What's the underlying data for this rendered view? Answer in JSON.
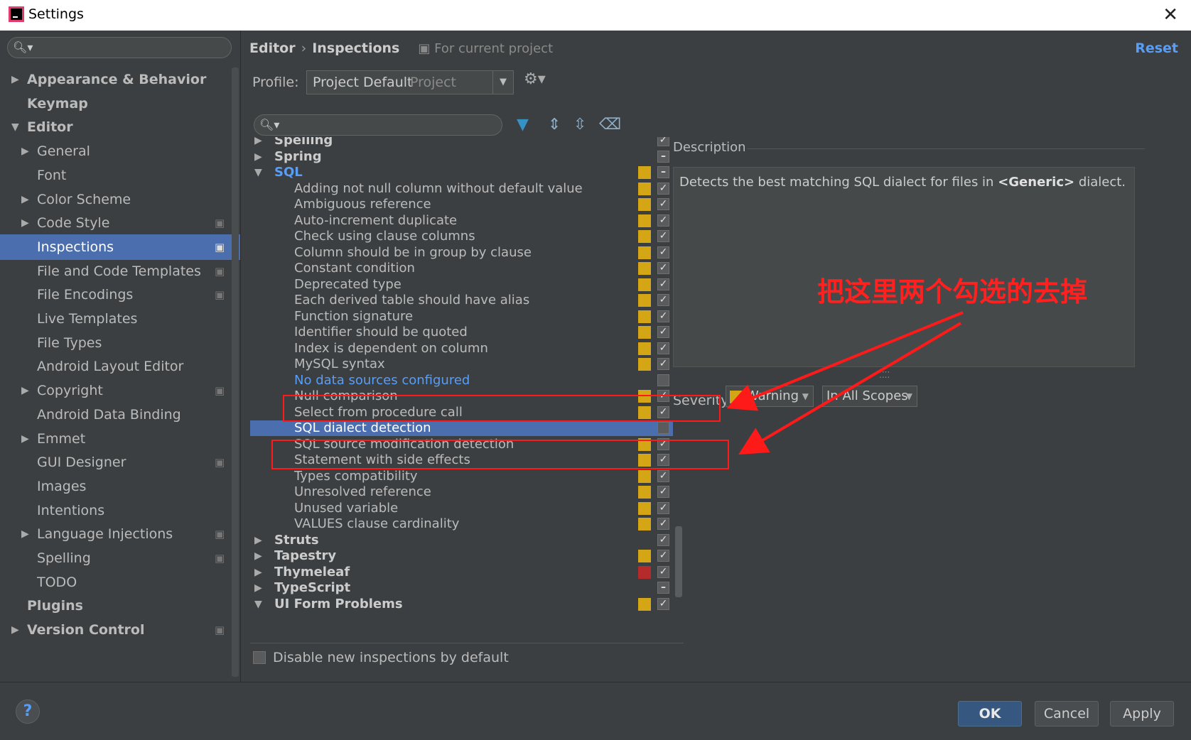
{
  "window": {
    "title": "Settings",
    "close_glyph": "✕"
  },
  "sidebar": {
    "items": [
      {
        "label": "Appearance & Behavior",
        "indent": 0,
        "arrow": "▶",
        "bold": true,
        "proj": false,
        "selected": false
      },
      {
        "label": "Keymap",
        "indent": 0,
        "arrow": "",
        "bold": true,
        "proj": false,
        "selected": false
      },
      {
        "label": "Editor",
        "indent": 0,
        "arrow": "▼",
        "bold": true,
        "proj": false,
        "selected": false
      },
      {
        "label": "General",
        "indent": 1,
        "arrow": "▶",
        "bold": false,
        "proj": false,
        "selected": false
      },
      {
        "label": "Font",
        "indent": 1,
        "arrow": "",
        "bold": false,
        "proj": false,
        "selected": false
      },
      {
        "label": "Color Scheme",
        "indent": 1,
        "arrow": "▶",
        "bold": false,
        "proj": false,
        "selected": false
      },
      {
        "label": "Code Style",
        "indent": 1,
        "arrow": "▶",
        "bold": false,
        "proj": true,
        "selected": false
      },
      {
        "label": "Inspections",
        "indent": 1,
        "arrow": "",
        "bold": false,
        "proj": true,
        "selected": true
      },
      {
        "label": "File and Code Templates",
        "indent": 1,
        "arrow": "",
        "bold": false,
        "proj": true,
        "selected": false
      },
      {
        "label": "File Encodings",
        "indent": 1,
        "arrow": "",
        "bold": false,
        "proj": true,
        "selected": false
      },
      {
        "label": "Live Templates",
        "indent": 1,
        "arrow": "",
        "bold": false,
        "proj": false,
        "selected": false
      },
      {
        "label": "File Types",
        "indent": 1,
        "arrow": "",
        "bold": false,
        "proj": false,
        "selected": false
      },
      {
        "label": "Android Layout Editor",
        "indent": 1,
        "arrow": "",
        "bold": false,
        "proj": false,
        "selected": false
      },
      {
        "label": "Copyright",
        "indent": 1,
        "arrow": "▶",
        "bold": false,
        "proj": true,
        "selected": false
      },
      {
        "label": "Android Data Binding",
        "indent": 1,
        "arrow": "",
        "bold": false,
        "proj": false,
        "selected": false
      },
      {
        "label": "Emmet",
        "indent": 1,
        "arrow": "▶",
        "bold": false,
        "proj": false,
        "selected": false
      },
      {
        "label": "GUI Designer",
        "indent": 1,
        "arrow": "",
        "bold": false,
        "proj": true,
        "selected": false
      },
      {
        "label": "Images",
        "indent": 1,
        "arrow": "",
        "bold": false,
        "proj": false,
        "selected": false
      },
      {
        "label": "Intentions",
        "indent": 1,
        "arrow": "",
        "bold": false,
        "proj": false,
        "selected": false
      },
      {
        "label": "Language Injections",
        "indent": 1,
        "arrow": "▶",
        "bold": false,
        "proj": true,
        "selected": false
      },
      {
        "label": "Spelling",
        "indent": 1,
        "arrow": "",
        "bold": false,
        "proj": true,
        "selected": false
      },
      {
        "label": "TODO",
        "indent": 1,
        "arrow": "",
        "bold": false,
        "proj": false,
        "selected": false
      },
      {
        "label": "Plugins",
        "indent": 0,
        "arrow": "",
        "bold": true,
        "proj": false,
        "selected": false
      },
      {
        "label": "Version Control",
        "indent": 0,
        "arrow": "▶",
        "bold": true,
        "proj": true,
        "selected": false
      }
    ]
  },
  "header": {
    "crumb_1": "Editor",
    "crumb_sep": "›",
    "crumb_2": "Inspections",
    "scope_note": "For current project",
    "reset_label": "Reset"
  },
  "profile": {
    "label": "Profile:",
    "value": "Project Default",
    "sub": "Project"
  },
  "inspections": {
    "rows": [
      {
        "label": "Spelling",
        "group": true,
        "arrow": "▶",
        "sev": "",
        "cb": "check",
        "style": ""
      },
      {
        "label": "Spring",
        "group": true,
        "arrow": "▶",
        "sev": "",
        "cb": "partial",
        "style": ""
      },
      {
        "label": "SQL",
        "group": true,
        "arrow": "▼",
        "sev": "warning",
        "cb": "partial",
        "style": "blue"
      },
      {
        "label": "Adding not null column without default value",
        "group": false,
        "arrow": "",
        "sev": "warning",
        "cb": "check",
        "style": ""
      },
      {
        "label": "Ambiguous reference",
        "group": false,
        "arrow": "",
        "sev": "warning",
        "cb": "check",
        "style": ""
      },
      {
        "label": "Auto-increment duplicate",
        "group": false,
        "arrow": "",
        "sev": "warning",
        "cb": "check",
        "style": ""
      },
      {
        "label": "Check using clause columns",
        "group": false,
        "arrow": "",
        "sev": "warning",
        "cb": "check",
        "style": ""
      },
      {
        "label": "Column should be in group by clause",
        "group": false,
        "arrow": "",
        "sev": "warning",
        "cb": "check",
        "style": ""
      },
      {
        "label": "Constant condition",
        "group": false,
        "arrow": "",
        "sev": "warning",
        "cb": "check",
        "style": ""
      },
      {
        "label": "Deprecated type",
        "group": false,
        "arrow": "",
        "sev": "warning",
        "cb": "check",
        "style": ""
      },
      {
        "label": "Each derived table should have alias",
        "group": false,
        "arrow": "",
        "sev": "warning",
        "cb": "check",
        "style": ""
      },
      {
        "label": "Function signature",
        "group": false,
        "arrow": "",
        "sev": "warning",
        "cb": "check",
        "style": ""
      },
      {
        "label": "Identifier should be quoted",
        "group": false,
        "arrow": "",
        "sev": "warning",
        "cb": "check",
        "style": ""
      },
      {
        "label": "Index is dependent on column",
        "group": false,
        "arrow": "",
        "sev": "warning",
        "cb": "check",
        "style": ""
      },
      {
        "label": "MySQL syntax",
        "group": false,
        "arrow": "",
        "sev": "warning",
        "cb": "check",
        "style": ""
      },
      {
        "label": "No data sources configured",
        "group": false,
        "arrow": "",
        "sev": "",
        "cb": "empty",
        "style": "blue"
      },
      {
        "label": "Null comparison",
        "group": false,
        "arrow": "",
        "sev": "warning",
        "cb": "check",
        "style": ""
      },
      {
        "label": "Select from procedure call",
        "group": false,
        "arrow": "",
        "sev": "warning",
        "cb": "check",
        "style": ""
      },
      {
        "label": "SQL dialect detection",
        "group": false,
        "arrow": "",
        "sev": "",
        "cb": "empty",
        "style": "selected"
      },
      {
        "label": "SQL source modification detection",
        "group": false,
        "arrow": "",
        "sev": "warning",
        "cb": "check",
        "style": ""
      },
      {
        "label": "Statement with side effects",
        "group": false,
        "arrow": "",
        "sev": "warning",
        "cb": "check",
        "style": ""
      },
      {
        "label": "Types compatibility",
        "group": false,
        "arrow": "",
        "sev": "warning",
        "cb": "check",
        "style": ""
      },
      {
        "label": "Unresolved reference",
        "group": false,
        "arrow": "",
        "sev": "warning",
        "cb": "check",
        "style": ""
      },
      {
        "label": "Unused variable",
        "group": false,
        "arrow": "",
        "sev": "warning",
        "cb": "check",
        "style": ""
      },
      {
        "label": "VALUES clause cardinality",
        "group": false,
        "arrow": "",
        "sev": "warning",
        "cb": "check",
        "style": ""
      },
      {
        "label": "Struts",
        "group": true,
        "arrow": "▶",
        "sev": "",
        "cb": "check",
        "style": ""
      },
      {
        "label": "Tapestry",
        "group": true,
        "arrow": "▶",
        "sev": "warning",
        "cb": "check",
        "style": ""
      },
      {
        "label": "Thymeleaf",
        "group": true,
        "arrow": "▶",
        "sev": "error",
        "cb": "check",
        "style": ""
      },
      {
        "label": "TypeScript",
        "group": true,
        "arrow": "▶",
        "sev": "",
        "cb": "partial",
        "style": ""
      },
      {
        "label": "UI Form Problems",
        "group": true,
        "arrow": "▼",
        "sev": "warning",
        "cb": "check",
        "style": ""
      }
    ]
  },
  "description": {
    "label": "Description",
    "text_before": "Detects the best matching SQL dialect for files in ",
    "text_bold": "<Generic>",
    "text_after": " dialect."
  },
  "severity": {
    "label": "Severity:",
    "value": "Warning",
    "scope": "In All Scopes"
  },
  "disable_new": {
    "label": "Disable new inspections by default"
  },
  "annotation": {
    "text": "把这里两个勾选的去掉"
  },
  "footer": {
    "help": "?",
    "ok": "OK",
    "cancel": "Cancel",
    "apply": "Apply"
  },
  "colors": {
    "warning": "#d4a514",
    "error": "#b52a2a",
    "selection": "#4b6eaf",
    "link": "#589df6",
    "annotation_red": "#ff1a1a"
  }
}
